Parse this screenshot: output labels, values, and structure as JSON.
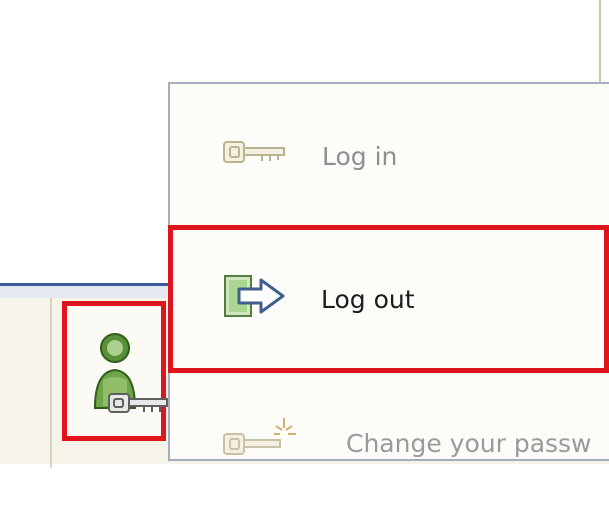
{
  "menu": {
    "items": [
      {
        "label": "Log in",
        "icon": "key-icon",
        "enabled": false
      },
      {
        "label": "Log out",
        "icon": "logout-arrow-icon",
        "enabled": true
      },
      {
        "label": "Change your passw",
        "icon": "key-sparkle-icon",
        "enabled": false
      }
    ]
  },
  "taskbar": {
    "user_button_icon": "user-key-icon"
  },
  "colors": {
    "highlight": "#e0141c",
    "taskbar_edge": "#3b5a9a",
    "disabled_text": "#8f8f8f"
  }
}
